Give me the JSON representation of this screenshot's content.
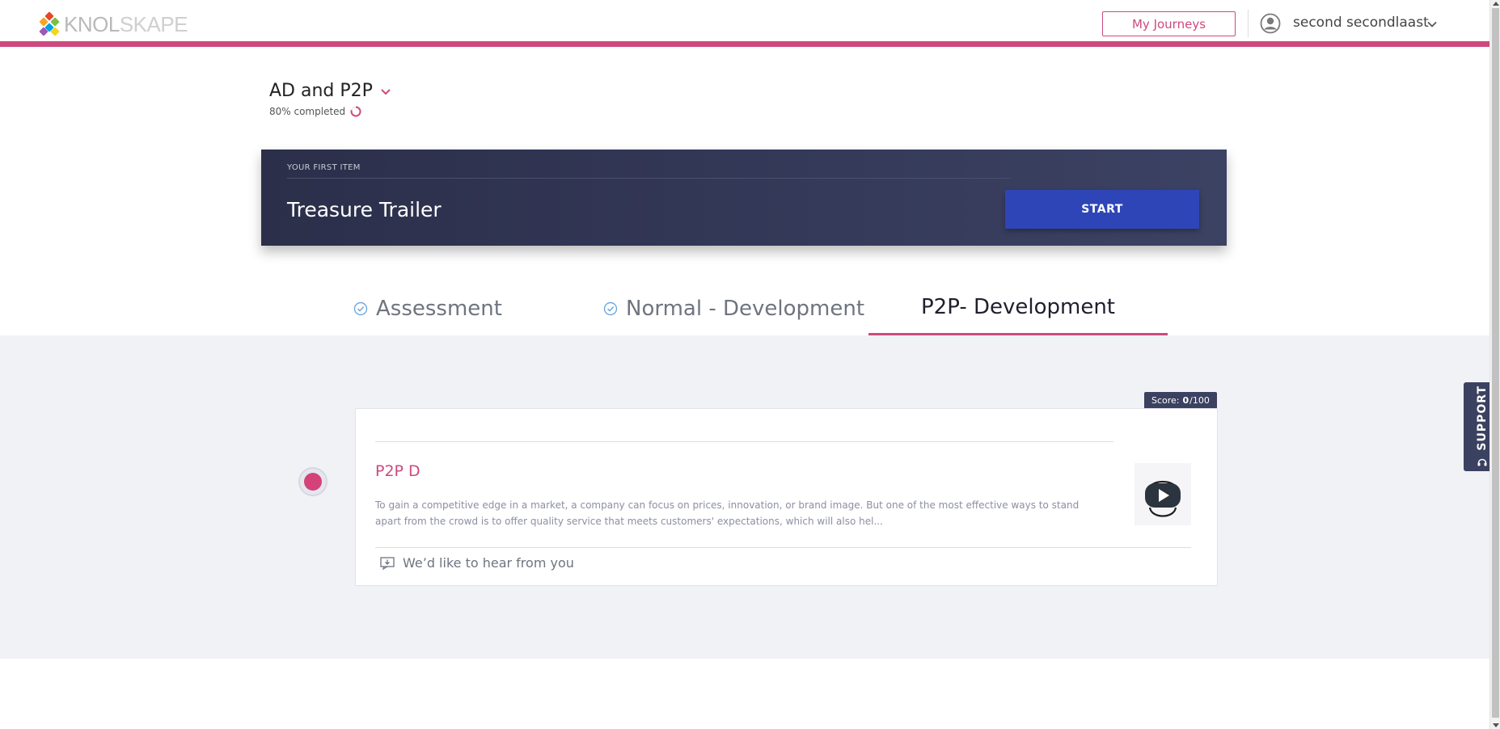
{
  "header": {
    "logo_text_1": "KNOL",
    "logo_text_2": "SKAPE",
    "my_journeys_label": "My Journeys",
    "user_name": "second secondlaast",
    "accent_color": "#cc4a7e"
  },
  "journey": {
    "title": "AD and P2P",
    "progress_text": "80% completed",
    "progress_value": 0.8
  },
  "banner": {
    "kicker": "YOUR FIRST ITEM",
    "title": "Treasure Trailer",
    "start_label": "START"
  },
  "tabs": [
    {
      "label": "Assessment",
      "completed": true,
      "active": false
    },
    {
      "label": "Normal - Development",
      "completed": true,
      "active": false
    },
    {
      "label": "P2P- Development",
      "completed": false,
      "active": true
    }
  ],
  "card": {
    "score_label": "Score:",
    "score_value": "0",
    "score_total": "/100",
    "title": "P2P D",
    "description": "To gain a competitive edge in a market, a company can focus on prices, innovation, or brand image. But one of the most effective ways to stand apart from the crowd is to offer quality service that meets customers' expectations, which will also hel...",
    "thumbnail_icon": "vr-video-icon",
    "feedback_label": "We’d like to hear from you"
  },
  "support": {
    "label": "SUPPORT"
  }
}
